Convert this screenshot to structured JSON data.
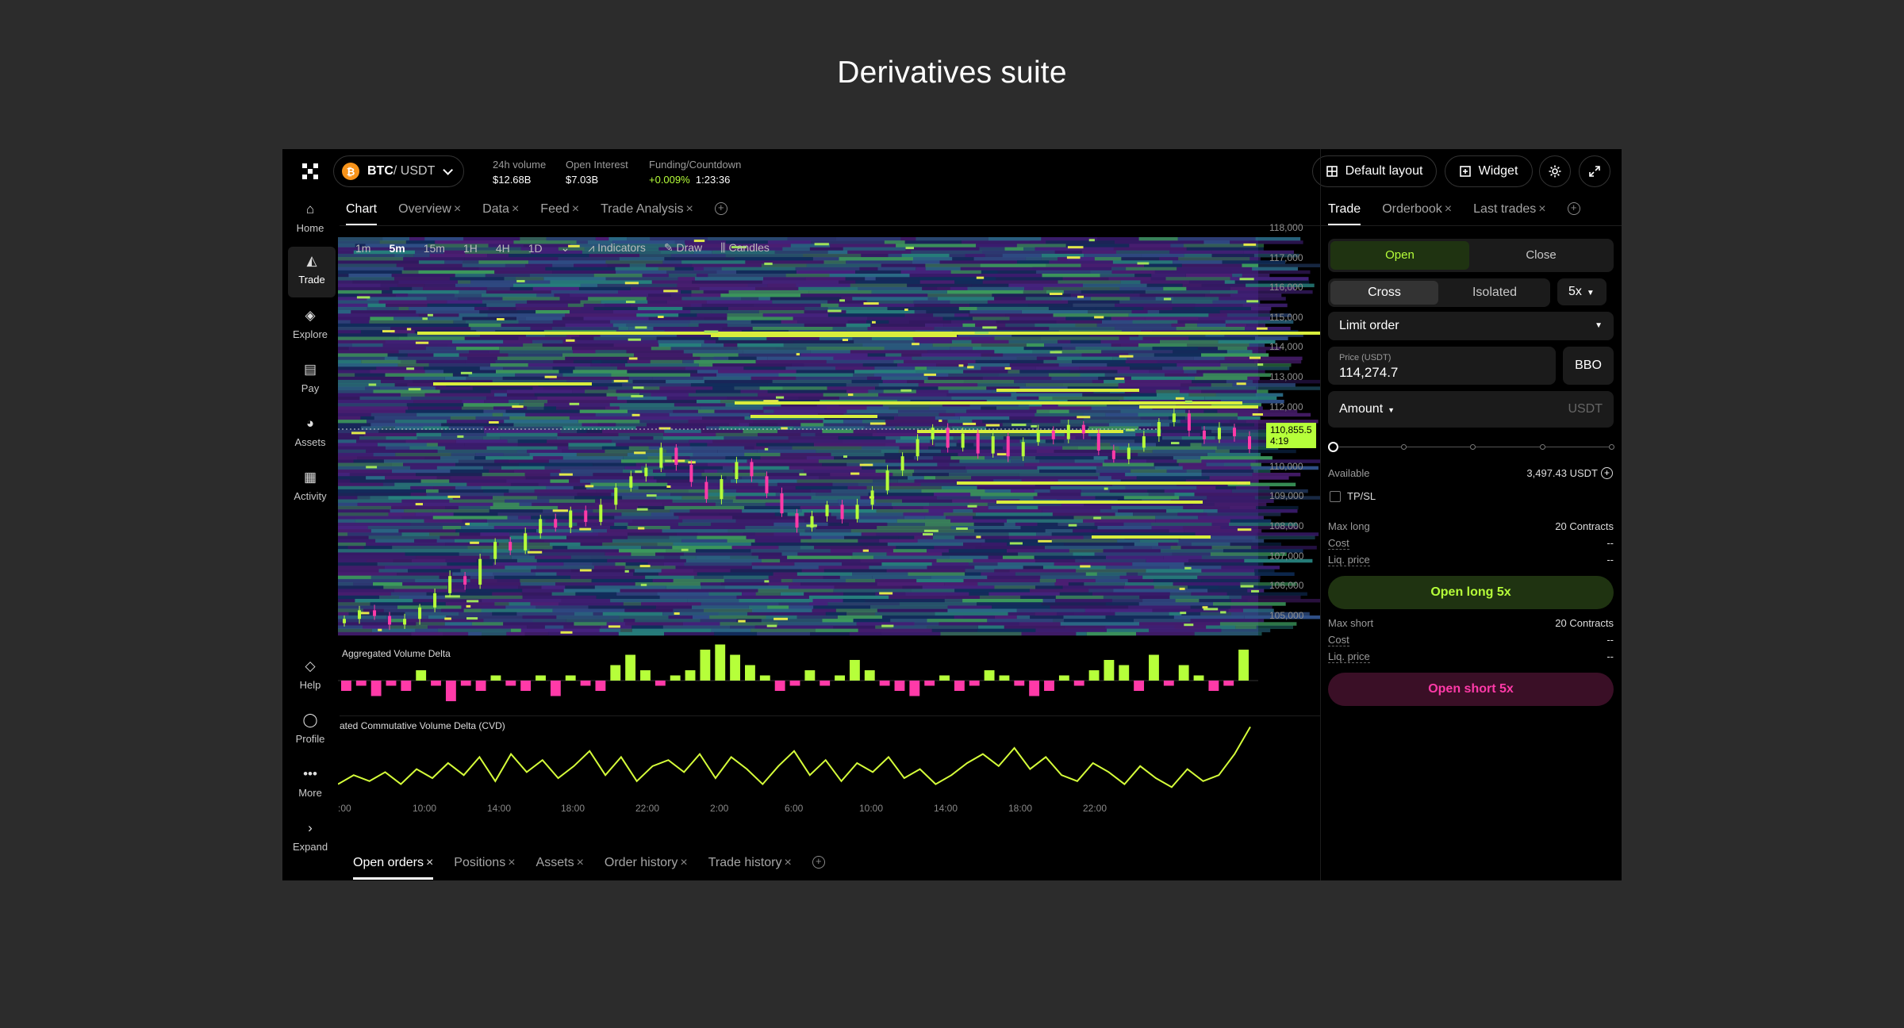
{
  "page": {
    "title": "Derivatives suite"
  },
  "header": {
    "pair_base": "BTC",
    "pair_quote": " / USDT",
    "volume_label": "24h volume",
    "volume_value": "$12.68B",
    "oi_label": "Open Interest",
    "oi_value": "$7.03B",
    "funding_label": "Funding/Countdown",
    "funding_rate": "+0.009%",
    "countdown": "1:23:36",
    "layout_btn": "Default layout",
    "widget_btn": "Widget"
  },
  "sidebar": {
    "items": [
      {
        "label": "Home",
        "icon": "home-icon"
      },
      {
        "label": "Trade",
        "icon": "trade-icon"
      },
      {
        "label": "Explore",
        "icon": "explore-icon"
      },
      {
        "label": "Pay",
        "icon": "pay-icon"
      },
      {
        "label": "Assets",
        "icon": "assets-icon"
      },
      {
        "label": "Activity",
        "icon": "activity-icon"
      },
      {
        "label": "Help",
        "icon": "help-icon"
      },
      {
        "label": "Profile",
        "icon": "profile-icon"
      },
      {
        "label": "More",
        "icon": "more-icon"
      },
      {
        "label": "Expand",
        "icon": "expand-icon"
      }
    ]
  },
  "main_tabs": [
    {
      "label": "Chart"
    },
    {
      "label": "Overview"
    },
    {
      "label": "Data"
    },
    {
      "label": "Feed"
    },
    {
      "label": "Trade Analysis"
    }
  ],
  "toolbar": {
    "intervals": [
      "1m",
      "5m",
      "15m",
      "1H",
      "4H",
      "1D"
    ],
    "active_interval": "5m",
    "indicators": "Indicators",
    "draw": "Draw",
    "candles": "Candles"
  },
  "price_axis": [
    "118,000",
    "117,000",
    "116,000",
    "115,000",
    "114,000",
    "113,000",
    "112,000",
    "111,000",
    "110,000",
    "109,000",
    "108,000",
    "107,000",
    "106,000",
    "105,000"
  ],
  "last_price": {
    "value": "110,855.5",
    "countdown": "4:19"
  },
  "avd_label": "Aggregated Volume Delta",
  "cvd_label": "ated Commutative Volume Delta (CVD)",
  "time_axis": [
    ":00",
    "10:00",
    "14:00",
    "18:00",
    "22:00",
    "2:00",
    "6:00",
    "10:00",
    "14:00",
    "18:00",
    "22:00"
  ],
  "bottom_tabs": [
    {
      "label": "Open orders"
    },
    {
      "label": "Positions"
    },
    {
      "label": "Assets"
    },
    {
      "label": "Order history"
    },
    {
      "label": "Trade history"
    }
  ],
  "right_tabs": [
    {
      "label": "Trade"
    },
    {
      "label": "Orderbook"
    },
    {
      "label": "Last trades"
    }
  ],
  "trade": {
    "open": "Open",
    "close": "Close",
    "cross": "Cross",
    "isolated": "Isolated",
    "leverage": "5x",
    "order_type": "Limit order",
    "price_label": "Price (USDT)",
    "price_value": "114,274.7",
    "bbo": "BBO",
    "amount_label": "Amount",
    "amount_unit": "USDT",
    "slider_fraction": 0,
    "available_label": "Available",
    "available_value": "3,497.43 USDT",
    "tpsl": "TP/SL",
    "max_long_label": "Max long",
    "max_long_value": "20 Contracts",
    "cost_label": "Cost",
    "cost_value": "--",
    "liq_label": "Liq. price",
    "liq_value": "--",
    "open_long": "Open long 5x",
    "max_short_label": "Max short",
    "max_short_value": "20 Contracts",
    "cost2_value": "--",
    "liq2_value": "--",
    "open_short": "Open short 5x"
  },
  "colors": {
    "accent": "#b6ff3a",
    "short": "#ff3aa8",
    "bg": "#000000"
  },
  "chart_data": [
    {
      "type": "heatmap",
      "title": "",
      "ylabel": "",
      "ylim": [
        104600,
        118000
      ],
      "series": [
        {
          "name": "",
          "type": "candlestick",
          "close": [
            104900,
            105200,
            105000,
            104700,
            104900,
            105300,
            105800,
            106400,
            106100,
            107000,
            107600,
            107300,
            107900,
            108400,
            108100,
            108700,
            108300,
            108900,
            109500,
            109900,
            110200,
            110900,
            110300,
            109700,
            109100,
            109800,
            110400,
            109900,
            109300,
            108600,
            108100,
            108500,
            108900,
            108400,
            108900,
            109400,
            110100,
            110600,
            111200,
            111600,
            110900,
            111400,
            110700,
            111300,
            110600,
            111100,
            111500,
            111200,
            111700,
            111400,
            110800,
            110500,
            110900,
            111300,
            111800,
            112100,
            111500,
            111200,
            111600,
            111300,
            110855
          ]
        }
      ]
    },
    {
      "type": "bar",
      "title": "",
      "ylabel": "",
      "series": [
        {
          "name": "Aggregated Volume Delta",
          "values": [
            -2,
            -1,
            -3,
            -1,
            -2,
            2,
            -1,
            -4,
            -1,
            -2,
            1,
            -1,
            -2,
            1,
            -3,
            1,
            -1,
            -2,
            3,
            5,
            2,
            -1,
            1,
            2,
            6,
            7,
            5,
            3,
            1,
            -2,
            -1,
            2,
            -1,
            1,
            4,
            2,
            -1,
            -2,
            -3,
            -1,
            1,
            -2,
            -1,
            2,
            1,
            -1,
            -3,
            -2,
            1,
            -1,
            2,
            4,
            3,
            -2,
            5,
            -1,
            3,
            1,
            -2,
            -1,
            6
          ]
        }
      ]
    },
    {
      "type": "line",
      "title": "",
      "ylabel": "",
      "series": [
        {
          "name": "ated Commutative Volume Delta (CVD)",
          "values": [
            3,
            6,
            4,
            7,
            3,
            8,
            5,
            10,
            6,
            12,
            4,
            13,
            7,
            11,
            5,
            9,
            14,
            6,
            12,
            4,
            9,
            11,
            7,
            13,
            5,
            12,
            8,
            3,
            9,
            14,
            6,
            11,
            4,
            10,
            7,
            12,
            5,
            8,
            3,
            6,
            10,
            13,
            9,
            15,
            8,
            12,
            6,
            4,
            10,
            7,
            3,
            9,
            5,
            2,
            8,
            4,
            6,
            13,
            22
          ]
        }
      ]
    }
  ]
}
